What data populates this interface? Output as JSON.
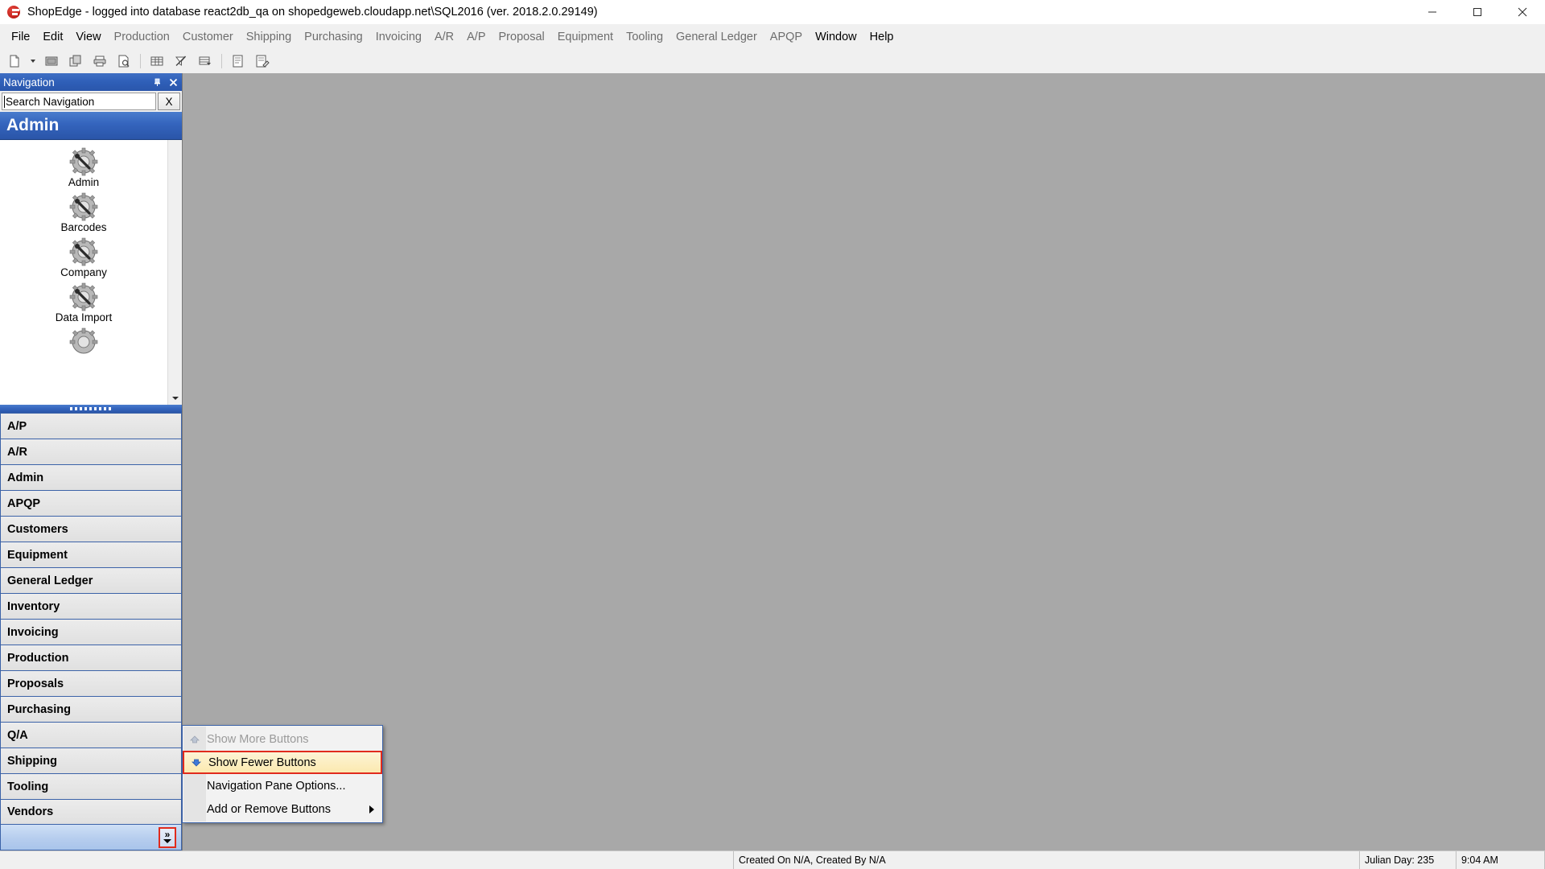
{
  "window": {
    "title": "ShopEdge -  logged into database react2db_qa on shopedgeweb.cloudapp.net\\SQL2016 (ver. 2018.2.0.29149)",
    "app_icon": "shopedge-logo-icon",
    "controls": {
      "minimize": "minimize-icon",
      "maximize": "maximize-icon",
      "close": "close-icon"
    }
  },
  "menubar": {
    "items": [
      {
        "label": "File",
        "enabled": true
      },
      {
        "label": "Edit",
        "enabled": true
      },
      {
        "label": "View",
        "enabled": true
      },
      {
        "label": "Production",
        "enabled": false
      },
      {
        "label": "Customer",
        "enabled": false
      },
      {
        "label": "Shipping",
        "enabled": false
      },
      {
        "label": "Purchasing",
        "enabled": false
      },
      {
        "label": "Invoicing",
        "enabled": false
      },
      {
        "label": "A/R",
        "enabled": false
      },
      {
        "label": "A/P",
        "enabled": false
      },
      {
        "label": "Proposal",
        "enabled": false
      },
      {
        "label": "Equipment",
        "enabled": false
      },
      {
        "label": "Tooling",
        "enabled": false
      },
      {
        "label": "General Ledger",
        "enabled": false
      },
      {
        "label": "APQP",
        "enabled": false
      },
      {
        "label": "Window",
        "enabled": true
      },
      {
        "label": "Help",
        "enabled": true
      }
    ]
  },
  "toolbar": {
    "buttons": [
      "new-document-icon",
      "new-document-dropdown-icon",
      "open-icon",
      "copy-icon",
      "print-icon",
      "print-preview-icon",
      "grid-icon",
      "filter-off-icon",
      "grid-filter-icon",
      "properties-icon",
      "edit-note-icon"
    ]
  },
  "navigation": {
    "caption": "Navigation",
    "pin_icon": "pin-icon",
    "close_icon": "close-icon",
    "search": {
      "value": "",
      "placeholder": "Search Navigation",
      "clear_label": "X"
    },
    "active_band": "Admin",
    "icons": [
      {
        "label": "Admin",
        "icon": "gear-wrench-icon"
      },
      {
        "label": "Barcodes",
        "icon": "gear-wrench-icon"
      },
      {
        "label": "Company",
        "icon": "gear-wrench-icon"
      },
      {
        "label": "Data Import",
        "icon": "gear-wrench-icon"
      }
    ],
    "scroll_down_icon": "chevron-down-icon",
    "bands": [
      "A/P",
      "A/R",
      "Admin",
      "APQP",
      "Customers",
      "Equipment",
      "General Ledger",
      "Inventory",
      "Invoicing",
      "Production",
      "Proposals",
      "Purchasing",
      "Q/A",
      "Shipping",
      "Tooling",
      "Vendors"
    ],
    "overflow_button": {
      "chevrons": "»",
      "icon": "configure-buttons-icon"
    }
  },
  "context_menu": {
    "items": [
      {
        "label": "Show More Buttons",
        "accel_before": "Show ",
        "accel_char": "M",
        "accel_after": "ore Buttons",
        "icon": "arrow-up-icon",
        "state": "disabled",
        "submenu": false
      },
      {
        "label": "Show Fewer Buttons",
        "accel_before": "Show ",
        "accel_char": "F",
        "accel_after": "ewer Buttons",
        "icon": "arrow-down-icon",
        "state": "highlighted",
        "submenu": false
      },
      {
        "label": "Navigation Pane Options...",
        "accel_before": "Na",
        "accel_char": "v",
        "accel_after": "igation Pane Options...",
        "icon": "none",
        "state": "normal",
        "submenu": false
      },
      {
        "label": "Add or Remove Buttons",
        "accel_before": "",
        "accel_char": "A",
        "accel_after": "dd or Remove Buttons",
        "icon": "none",
        "state": "normal",
        "submenu": true
      }
    ]
  },
  "statusbar": {
    "left": "",
    "created_info": "Created On N/A, Created By N/A",
    "julian_day": "Julian Day: 235",
    "time": "9:04 AM"
  },
  "colors": {
    "accent_blue": "#2f5fb8",
    "band_blue": "#3464bd",
    "highlight_red": "#e02b1d",
    "menu_highlight": "#fbe9b0",
    "mdi_background": "#a8a8a8"
  }
}
